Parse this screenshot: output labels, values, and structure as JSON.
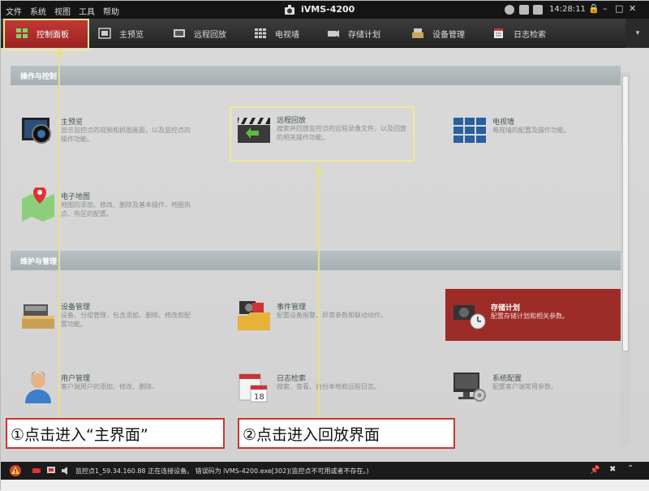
{
  "app": {
    "title": "iVMS-4200",
    "clock": "14:28:11"
  },
  "menu": {
    "items": [
      "文件",
      "系统",
      "视图",
      "工具",
      "帮助"
    ]
  },
  "tabs": [
    {
      "label": "控制面板",
      "icon": "grid-icon"
    },
    {
      "label": "主预览",
      "icon": "preview-icon"
    },
    {
      "label": "远程回放",
      "icon": "playback-icon"
    },
    {
      "label": "电视墙",
      "icon": "tv-wall-icon"
    },
    {
      "label": "存储计划",
      "icon": "storage-icon"
    },
    {
      "label": "设备管理",
      "icon": "device-icon"
    },
    {
      "label": "日志检索",
      "icon": "log-icon"
    }
  ],
  "sections": [
    {
      "title": "操作与控制"
    },
    {
      "title": "维护与管理"
    }
  ],
  "operation_tiles": [
    {
      "title": "主预览",
      "desc": "显示监控点的视频和抓图画面，以及监控点的操作功能。"
    },
    {
      "title": "远程回放",
      "desc": "搜索并回放监控点的远程录像文件，以及回放的相关操作功能。"
    },
    {
      "title": "电视墙",
      "desc": "电视墙的配置及操作功能。"
    },
    {
      "title": "电子地图",
      "desc": "地图的添加、修改、删除及基本操作，地图热点、热区的配置。"
    }
  ],
  "management_tiles": [
    {
      "title": "设备管理",
      "desc": "设备、分组管理，包含添加、删除、修改和配置功能。"
    },
    {
      "title": "事件管理",
      "desc": "配置设备报警、异常参数和联动动作。"
    },
    {
      "title": "存储计划",
      "desc": "配置存储计划和相关参数。"
    },
    {
      "title": "用户管理",
      "desc": "客户端用户的添加、修改、删除。"
    },
    {
      "title": "日志检索",
      "desc": "搜索、查看、备份本地和远程日志。"
    },
    {
      "title": "系统配置",
      "desc": "配置客户端常用参数。"
    }
  ],
  "annotations": {
    "callout1": "①点击进入“主界面”",
    "callout2": "②点击进入回放界面"
  },
  "status": {
    "text": "监控点1_59.34.160.88 正在连接设备。 错误码为 iVMS-4200.exe[302](监控点不可用或者不存在。)"
  },
  "colors": {
    "accent": "#b5302c",
    "annotation": "#e8e08a",
    "callout_border": "#c8362f"
  }
}
